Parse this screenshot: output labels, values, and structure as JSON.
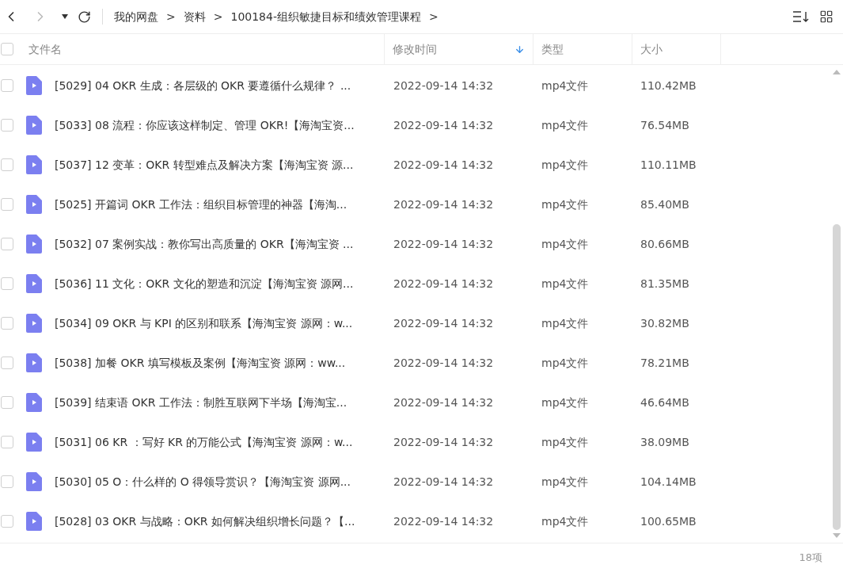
{
  "breadcrumb": [
    "我的网盘",
    "资料",
    "100184-组织敏捷目标和绩效管理课程"
  ],
  "breadcrumb_separator": ">",
  "header": {
    "checked": false,
    "columns": [
      {
        "label": "文件名",
        "sorted": false
      },
      {
        "label": "修改时间",
        "sorted": true
      },
      {
        "label": "类型",
        "sorted": false
      },
      {
        "label": "大小",
        "sorted": false
      }
    ]
  },
  "rows": [
    {
      "name": "[5029] 04  OKR 生成：各层级的 OKR 要遵循什么规律？ ...",
      "modified": "2022-09-14 14:32",
      "type": "mp4文件",
      "size": "110.42MB",
      "checked": false
    },
    {
      "name": "[5033] 08  流程：你应该这样制定、管理 OKR!【海淘宝资...",
      "modified": "2022-09-14 14:32",
      "type": "mp4文件",
      "size": "76.54MB",
      "checked": false
    },
    {
      "name": "[5037] 12  变革：OKR 转型难点及解决方案【海淘宝资 源...",
      "modified": "2022-09-14 14:32",
      "type": "mp4文件",
      "size": "110.11MB",
      "checked": false
    },
    {
      "name": "[5025] 开篇词  OKR 工作法：组织目标管理的神器【海淘...",
      "modified": "2022-09-14 14:32",
      "type": "mp4文件",
      "size": "85.40MB",
      "checked": false
    },
    {
      "name": "[5032] 07  案例实战：教你写出高质量的 OKR【海淘宝资 ...",
      "modified": "2022-09-14 14:32",
      "type": "mp4文件",
      "size": "80.66MB",
      "checked": false
    },
    {
      "name": "[5036] 11  文化：OKR 文化的塑造和沉淀【海淘宝资 源网...",
      "modified": "2022-09-14 14:32",
      "type": "mp4文件",
      "size": "81.35MB",
      "checked": false
    },
    {
      "name": "[5034] 09  OKR 与 KPI 的区别和联系【海淘宝资 源网：w...",
      "modified": "2022-09-14 14:32",
      "type": "mp4文件",
      "size": "30.82MB",
      "checked": false
    },
    {
      "name": "[5038] 加餐  OKR 填写模板及案例【海淘宝资 源网：ww...",
      "modified": "2022-09-14 14:32",
      "type": "mp4文件",
      "size": "78.21MB",
      "checked": false
    },
    {
      "name": "[5039] 结束语  OKR 工作法：制胜互联网下半场【海淘宝...",
      "modified": "2022-09-14 14:32",
      "type": "mp4文件",
      "size": "46.64MB",
      "checked": false
    },
    {
      "name": "[5031] 06  KR ：写好 KR 的万能公式【海淘宝资 源网：w...",
      "modified": "2022-09-14 14:32",
      "type": "mp4文件",
      "size": "38.09MB",
      "checked": false
    },
    {
      "name": "[5030] 05  O：什么样的 O 得领导赏识？【海淘宝资 源网...",
      "modified": "2022-09-14 14:32",
      "type": "mp4文件",
      "size": "104.14MB",
      "checked": false
    },
    {
      "name": "[5028] 03  OKR 与战略：OKR 如何解决组织增长问题？【...",
      "modified": "2022-09-14 14:32",
      "type": "mp4文件",
      "size": "100.65MB",
      "checked": false
    }
  ],
  "status_bar": {
    "count": "18项"
  }
}
